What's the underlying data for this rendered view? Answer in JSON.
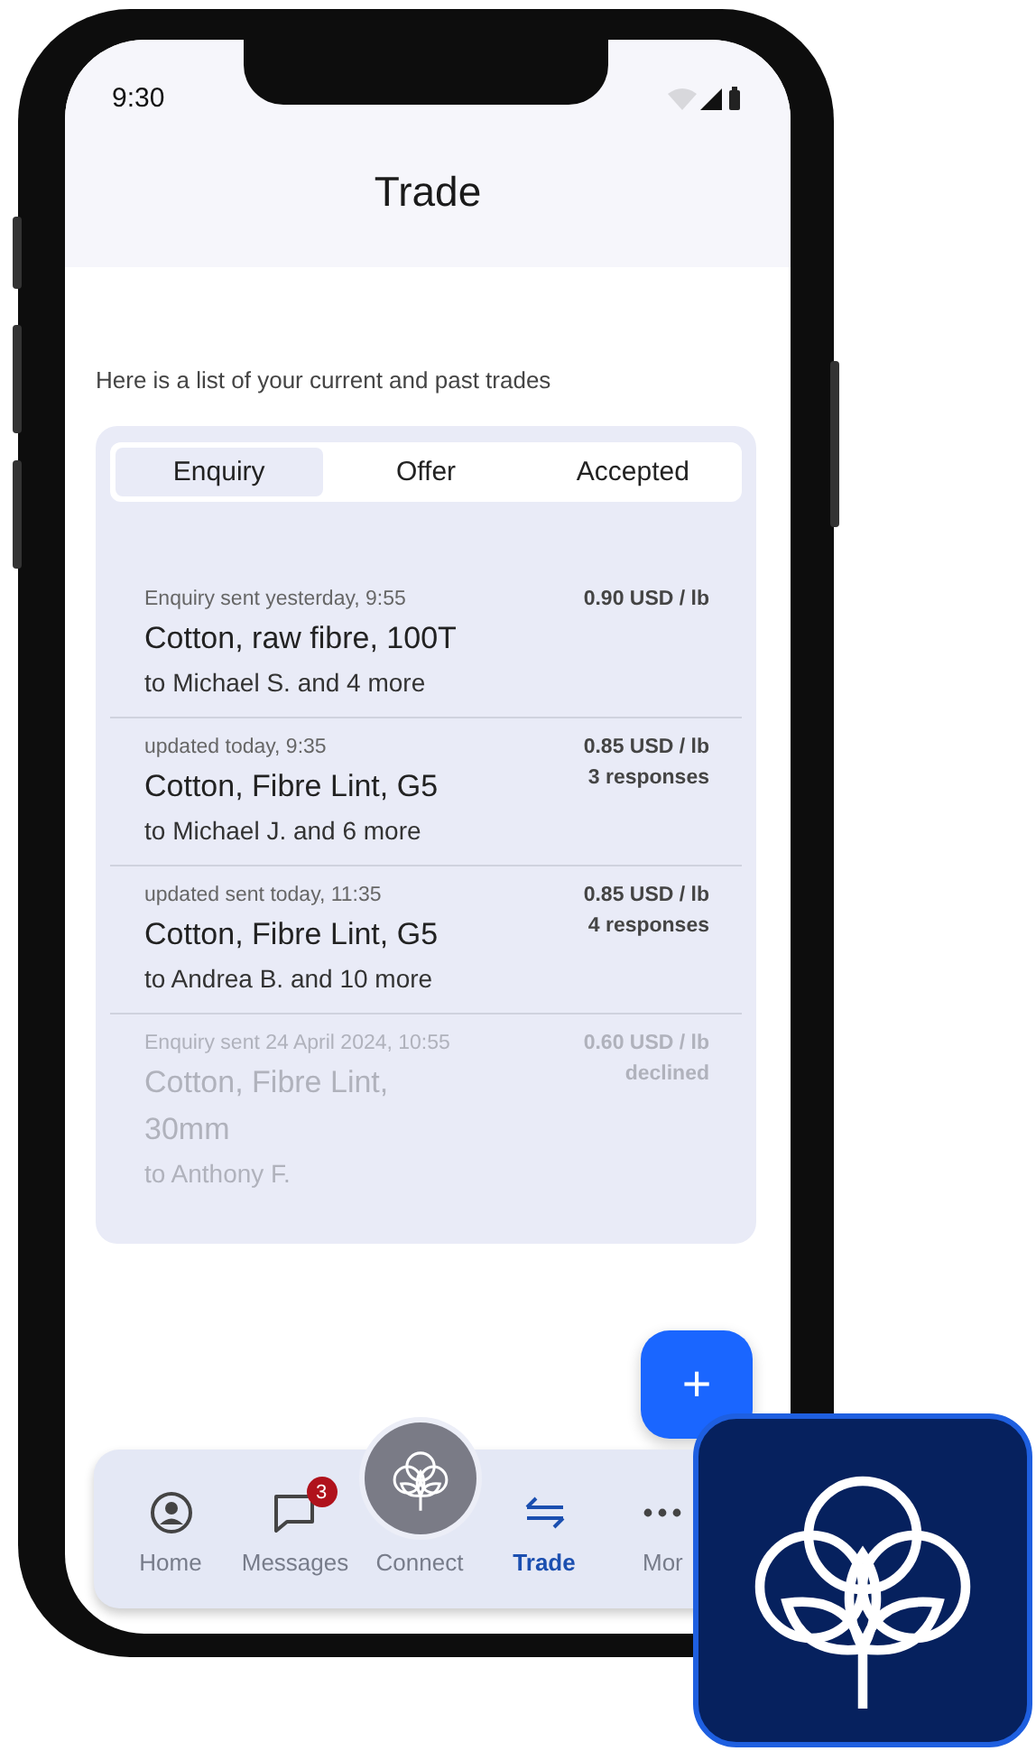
{
  "status_bar": {
    "time": "9:30"
  },
  "header": {
    "title": "Trade"
  },
  "intro": "Here is a list of your current and past trades",
  "tabs": [
    {
      "label": "Enquiry",
      "selected": true
    },
    {
      "label": "Offer",
      "selected": false
    },
    {
      "label": "Accepted",
      "selected": false
    }
  ],
  "trades": [
    {
      "meta": "Enquiry sent yesterday, 9:55",
      "title": "Cotton, raw fibre, 100T",
      "recipients": "to Michael S. and 4 more",
      "price": "0.90 USD / lb",
      "dimmed": false
    },
    {
      "meta": "updated today, 9:35",
      "title": "Cotton, Fibre Lint, G5",
      "recipients": "to Michael J. and 6 more",
      "price": "0.85 USD / lb",
      "note": "3 responses",
      "dimmed": false
    },
    {
      "meta": "updated sent today, 11:35",
      "title": "Cotton, Fibre Lint, G5",
      "recipients": "to Andrea B. and 10 more",
      "price": "0.85 USD / lb",
      "note": "4 responses",
      "dimmed": false
    },
    {
      "meta": "Enquiry sent 24 April 2024, 10:55",
      "title": "Cotton, Fibre Lint, 30mm",
      "recipients": "to Anthony F.",
      "price": "0.60 USD / lb",
      "note": "declined",
      "dimmed": true
    }
  ],
  "fab": {
    "label": "+"
  },
  "nav": [
    {
      "kind": "home",
      "label": "Home",
      "selected": false
    },
    {
      "kind": "messages",
      "label": "Messages",
      "badge": "3",
      "selected": false
    },
    {
      "kind": "connect",
      "label": "Connect",
      "selected": false
    },
    {
      "kind": "trade",
      "label": "Trade",
      "selected": true
    },
    {
      "kind": "more",
      "label": "Mor",
      "selected": false
    }
  ]
}
